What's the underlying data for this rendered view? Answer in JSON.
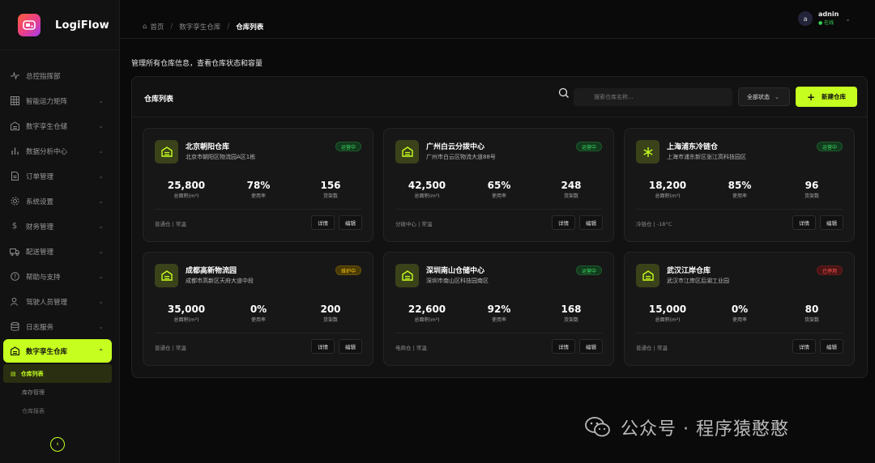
{
  "app": {
    "name": "LogiFlow"
  },
  "sidebar": {
    "items": [
      {
        "label": "总控指挥部",
        "icon": "pulse-icon",
        "chevron": false
      },
      {
        "label": "智能运力矩阵",
        "icon": "grid-icon",
        "chevron": true
      },
      {
        "label": "数字孪生仓储",
        "icon": "warehouse-icon",
        "chevron": true
      },
      {
        "label": "数据分析中心",
        "icon": "bar-chart-icon",
        "chevron": true
      },
      {
        "label": "订单管理",
        "icon": "document-icon",
        "chevron": true
      },
      {
        "label": "系统设置",
        "icon": "gear-icon",
        "chevron": true
      },
      {
        "label": "财务管理",
        "icon": "dollar-icon",
        "chevron": true
      },
      {
        "label": "配送管理",
        "icon": "truck-icon",
        "chevron": true
      },
      {
        "label": "帮助与支持",
        "icon": "help-icon",
        "chevron": true
      },
      {
        "label": "驾驶人员管理",
        "icon": "user-icon",
        "chevron": true
      },
      {
        "label": "日志服务",
        "icon": "database-icon",
        "chevron": true
      },
      {
        "label": "数字孪生仓库",
        "icon": "warehouse-icon",
        "chevron": true,
        "active": true
      }
    ],
    "sub_items": [
      {
        "label": "仓库列表",
        "active": true
      },
      {
        "label": "库存管理"
      },
      {
        "label": "仓库报表"
      }
    ]
  },
  "header": {
    "breadcrumb": {
      "home": "首页",
      "parent": "数字孪生仓库",
      "current": "仓库列表"
    },
    "user": {
      "initial": "a",
      "name": "adnin",
      "status": "● 在线"
    }
  },
  "page": {
    "description": "管理所有仓库信息，查看仓库状态和容量"
  },
  "panel": {
    "title": "仓库列表",
    "search_placeholder": "搜索仓库名称...",
    "status_filter": "全部状态",
    "new_button": "新建仓库"
  },
  "stat_labels": {
    "area": "总面积(m²)",
    "usage": "使用率",
    "shelves": "货架数"
  },
  "actions": {
    "detail": "详情",
    "edit": "编辑"
  },
  "warehouses": [
    {
      "name": "北京朝阳仓库",
      "address": "北京市朝阳区物流园A区1栋",
      "status": "运营中",
      "status_color": "#3ddc62",
      "area": "25,800",
      "usage": "78%",
      "shelves": "156",
      "meta": "普通仓 | 常温",
      "icon": "warehouse-icon"
    },
    {
      "name": "广州白云分拨中心",
      "address": "广州市白云区物流大道88号",
      "status": "运营中",
      "status_color": "#3ddc62",
      "area": "42,500",
      "usage": "65%",
      "shelves": "248",
      "meta": "分拨中心 | 常温",
      "icon": "warehouse-icon"
    },
    {
      "name": "上海浦东冷链仓",
      "address": "上海市浦东新区张江高科技园区",
      "status": "运营中",
      "status_color": "#3ddc62",
      "area": "18,200",
      "usage": "85%",
      "shelves": "96",
      "meta": "冷链仓 | -18°C",
      "icon": "snowflake-icon"
    },
    {
      "name": "成都高新物流园",
      "address": "成都市高新区天府大道中段",
      "status": "维护中",
      "status_color": "#f6c50b",
      "area": "35,000",
      "usage": "0%",
      "shelves": "200",
      "meta": "普通仓 | 常温",
      "icon": "warehouse-icon"
    },
    {
      "name": "深圳南山仓储中心",
      "address": "深圳市南山区科技园南区",
      "status": "运营中",
      "status_color": "#3ddc62",
      "area": "22,600",
      "usage": "92%",
      "shelves": "168",
      "meta": "电商仓 | 常温",
      "icon": "warehouse-icon"
    },
    {
      "name": "武汉江岸仓库",
      "address": "武汉市江岸区后湖工业园",
      "status": "已停用",
      "status_color": "#ff5555",
      "area": "15,000",
      "usage": "0%",
      "shelves": "80",
      "meta": "普通仓 | 常温",
      "icon": "warehouse-icon"
    }
  ],
  "watermark": {
    "text": "公众号 · 程序猿憨憨"
  },
  "colors": {
    "accent": "#c6ff1f",
    "background": "#0a0a0a",
    "card": "#171717"
  }
}
